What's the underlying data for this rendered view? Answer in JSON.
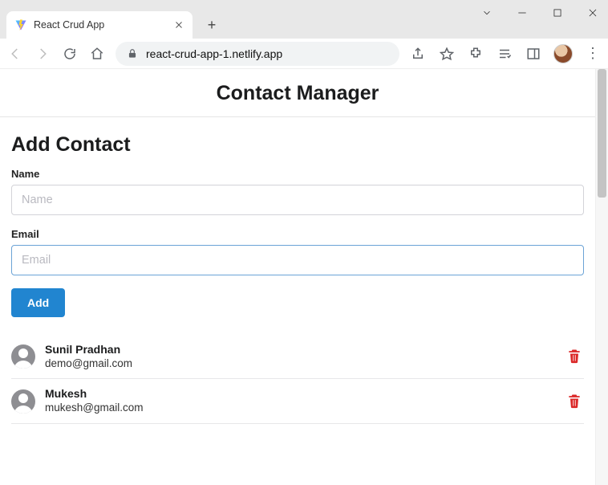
{
  "browser": {
    "tab_title": "React Crud App",
    "url_host": "react-crud-app-1.netlify.app",
    "url_path": ""
  },
  "header": {
    "title": "Contact Manager"
  },
  "form": {
    "section_title": "Add Contact",
    "name_label": "Name",
    "name_placeholder": "Name",
    "name_value": "",
    "email_label": "Email",
    "email_placeholder": "Email",
    "email_value": "",
    "submit_label": "Add"
  },
  "contacts": [
    {
      "name": "Sunil Pradhan",
      "email": "demo@gmail.com"
    },
    {
      "name": "Mukesh",
      "email": "mukesh@gmail.com"
    }
  ]
}
